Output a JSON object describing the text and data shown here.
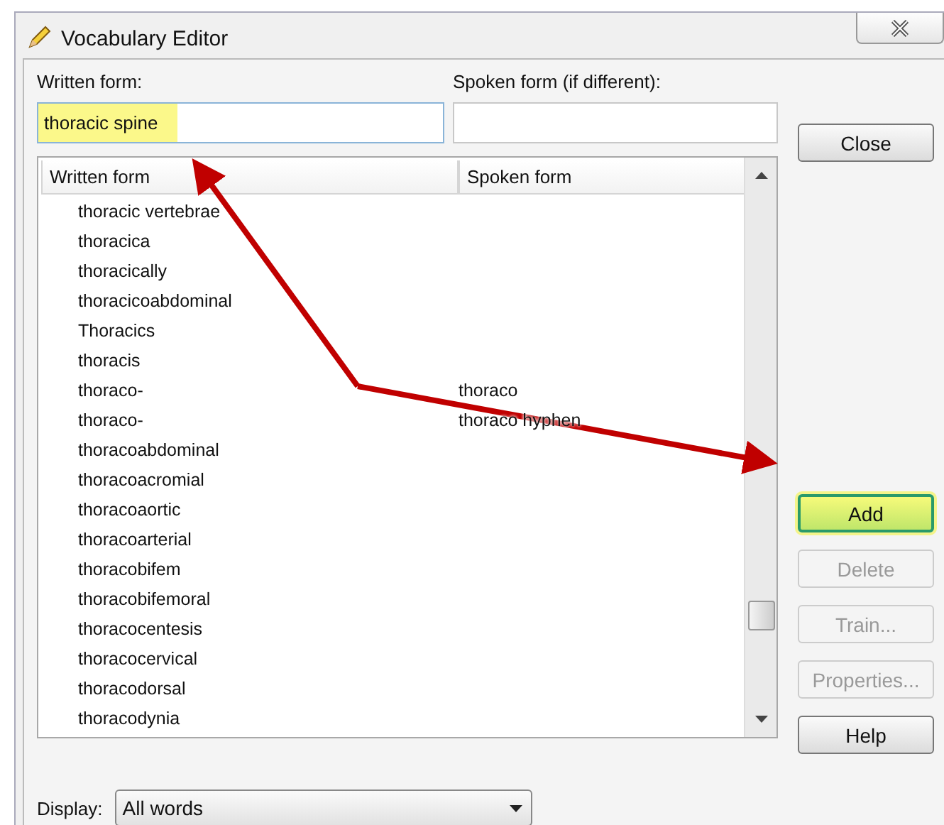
{
  "window": {
    "title": "Vocabulary Editor"
  },
  "written_form": {
    "label": "Written form:",
    "value": "thoracic spine",
    "highlighted": true
  },
  "spoken_form": {
    "label": "Spoken form (if different):"
  },
  "list": {
    "columns": [
      "Written form",
      "Spoken form"
    ],
    "rows": [
      {
        "written": "thoracic vertebrae"
      },
      {
        "written": "thoracica"
      },
      {
        "written": "thoracically"
      },
      {
        "written": "thoracicoabdominal"
      },
      {
        "written": "Thoracics"
      },
      {
        "written": "thoracis"
      },
      {
        "written": "thoraco-",
        "spoken": "thoraco"
      },
      {
        "written": "thoraco-",
        "spoken": "thoraco hyphen"
      },
      {
        "written": "thoracoabdominal"
      },
      {
        "written": "thoracoacromial"
      },
      {
        "written": "thoracoaortic"
      },
      {
        "written": "thoracoarterial"
      },
      {
        "written": "thoracobifem"
      },
      {
        "written": "thoracobifemoral"
      },
      {
        "written": "thoracocentesis"
      },
      {
        "written": "thoracocervical"
      },
      {
        "written": "thoracodorsal"
      },
      {
        "written": "thoracodynia"
      }
    ]
  },
  "close_button": {
    "label": "Close"
  },
  "buttons": [
    {
      "label": "Add",
      "disabled": false,
      "highlighted": true
    },
    {
      "label": "Delete",
      "disabled": true,
      "highlighted": false
    },
    {
      "label": "Train...",
      "disabled": true,
      "highlighted": false
    },
    {
      "label": "Properties...",
      "disabled": true,
      "highlighted": false
    },
    {
      "label": "Help",
      "disabled": false,
      "highlighted": false
    }
  ],
  "display": {
    "label": "Display:",
    "value": "All words"
  }
}
